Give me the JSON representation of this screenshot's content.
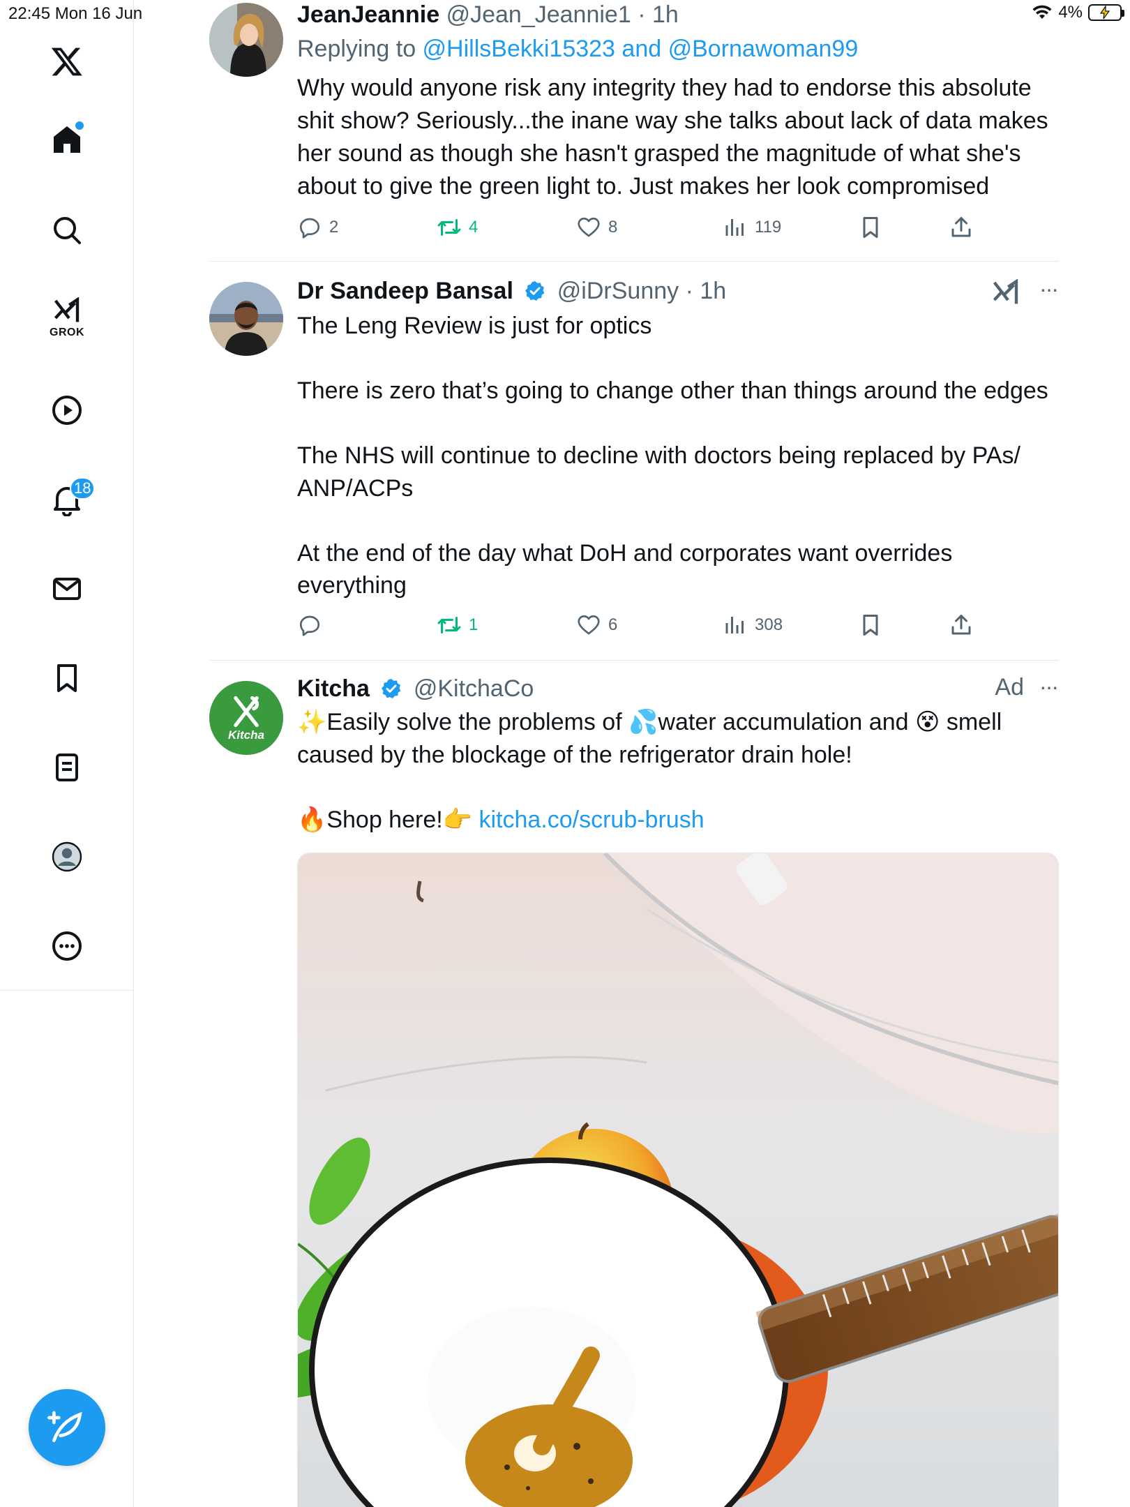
{
  "status_bar": {
    "time_date": "22:45   Mon 16 Jun",
    "battery": "4%"
  },
  "sidebar": {
    "grok_label": "GROK",
    "notifications_badge": "18"
  },
  "tweets": [
    {
      "name": "JeanJeannie",
      "handle": "@Jean_Jeannie1",
      "time": "· 1h",
      "reply_prefix": "Replying to ",
      "reply_users": "@HillsBekki15323 and @Bornawoman99",
      "text": "Why would anyone risk any integrity they had to endorse this absolute shit show? Seriously...the inane way she talks about lack of data makes her sound as though she hasn't grasped the magnitude of what she's about to give the green light to. Just makes her look compromised",
      "replies": "2",
      "retweets": "4",
      "likes": "8",
      "views": "119"
    },
    {
      "name": "Dr Sandeep Bansal",
      "handle": "@iDrSunny",
      "time": "· 1h",
      "more": "···",
      "text": "The Leng Review is just for optics\n\nThere is zero that’s going to change other than things around the edges\n\nThe NHS will continue to decline with doctors being replaced by PAs/ ANP/ACPs\n\nAt the end of the day what DoH and corporates want overrides everything",
      "replies": "",
      "retweets": "1",
      "likes": "6",
      "views": "308"
    },
    {
      "name": "Kitcha",
      "handle": "@KitchaCo",
      "ad_label": "Ad",
      "more": "···",
      "avatar_text": "Kitcha",
      "text_part1": "✨Easily solve the problems of 💦water accumulation and 😵 smell caused by the blockage of the refrigerator drain hole!",
      "shop_text": "🔥Shop here!👉 ",
      "shop_link": "kitcha.co/scrub-brush"
    }
  ],
  "colors": {
    "accent": "#1d9bf0",
    "retweet_green": "#00ba7c",
    "secondary_text": "#536471",
    "kitcha_green": "#3a9a3e"
  }
}
